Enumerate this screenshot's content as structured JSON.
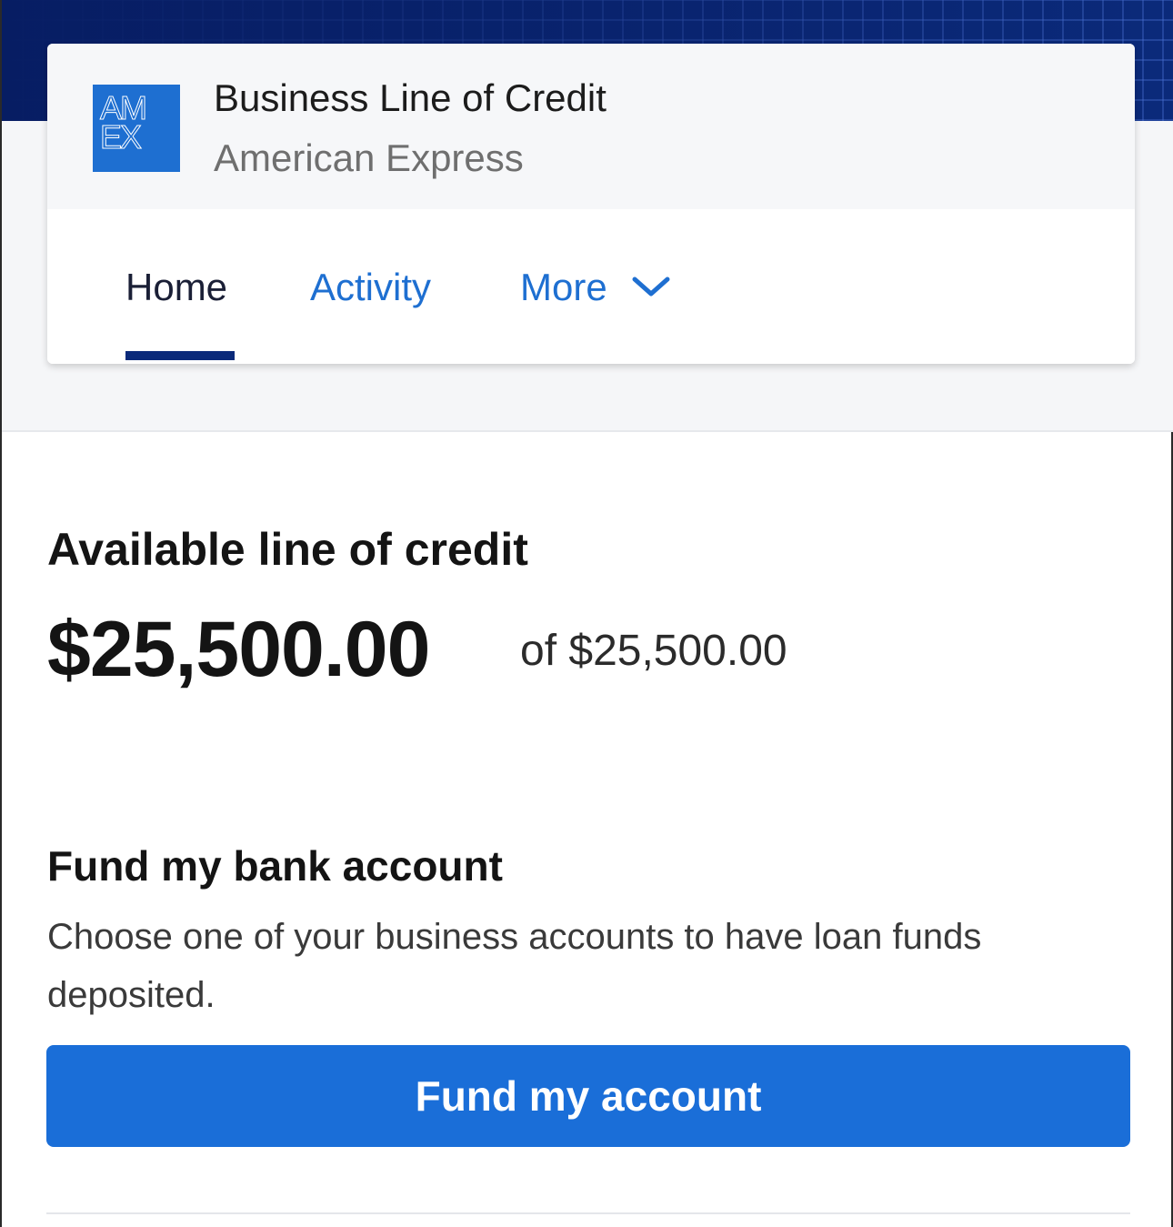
{
  "header": {
    "logo": {
      "lines": [
        "AM",
        "EX"
      ],
      "color": "#1e6fd1"
    },
    "title": "Business Line of Credit",
    "subtitle": "American Express"
  },
  "tabs": [
    {
      "label": "Home",
      "active": true
    },
    {
      "label": "Activity",
      "active": false
    },
    {
      "label": "More",
      "active": false,
      "icon": "chevron-down-icon"
    }
  ],
  "credit": {
    "title": "Available line of credit",
    "available": "$25,500.00",
    "total": "of $25,500.00"
  },
  "fund": {
    "title": "Fund my bank account",
    "description": "Choose one of your business accounts to have loan funds deposited.",
    "button_label": "Fund my account"
  },
  "colors": {
    "brand_blue": "#1e6fd1",
    "navy": "#0b2a7a",
    "button_blue": "#1a6ed8"
  }
}
